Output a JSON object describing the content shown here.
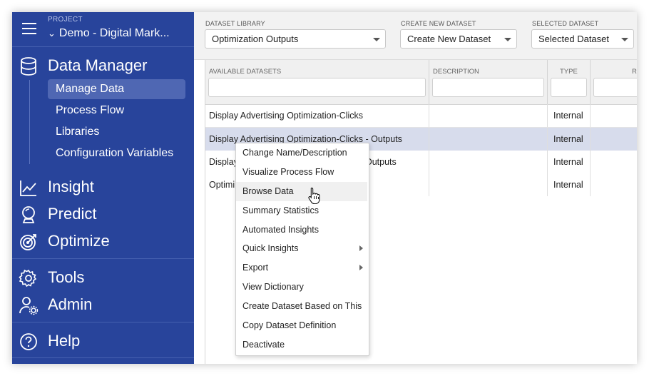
{
  "sidebar": {
    "project_label": "PROJECT",
    "project_name": "Demo - Digital Mark...",
    "data_manager": {
      "label": "Data Manager",
      "items": [
        {
          "label": "Manage Data",
          "active": true
        },
        {
          "label": "Process Flow",
          "active": false
        },
        {
          "label": "Libraries",
          "active": false
        },
        {
          "label": "Configuration Variables",
          "active": false
        }
      ]
    },
    "insight": "Insight",
    "predict": "Predict",
    "optimize": "Optimize",
    "tools": "Tools",
    "admin": "Admin",
    "help": "Help"
  },
  "toolbar": {
    "library_label": "DATASET LIBRARY",
    "library_value": "Optimization Outputs",
    "create_label": "CREATE NEW DATASET",
    "create_value": "Create New Dataset",
    "selected_label": "SELECTED DATASET",
    "selected_value": "Selected Dataset"
  },
  "grid": {
    "columns": [
      "AVAILABLE DATASETS",
      "DESCRIPTION",
      "TYPE",
      "R"
    ],
    "rows": [
      {
        "name": "Display Advertising Optimization-Clicks",
        "description": "",
        "type": "Internal"
      },
      {
        "name": "Display Advertising Optimization-Clicks - Outputs",
        "description": "",
        "type": "Internal"
      },
      {
        "name": "Display",
        "name_tail": "Outputs",
        "description": "",
        "type": "Internal"
      },
      {
        "name": "Optimi",
        "description": "",
        "type": "Internal"
      }
    ]
  },
  "context_menu": {
    "items": [
      {
        "label": "Change Name/Description",
        "submenu": false
      },
      {
        "label": "Visualize Process Flow",
        "submenu": false
      },
      {
        "label": "Browse Data",
        "submenu": false,
        "hover": true
      },
      {
        "label": "Summary Statistics",
        "submenu": false
      },
      {
        "label": "Automated Insights",
        "submenu": false
      },
      {
        "label": "Quick Insights",
        "submenu": true
      },
      {
        "label": "Export",
        "submenu": true
      },
      {
        "label": "View Dictionary",
        "submenu": false
      },
      {
        "label": "Create Dataset Based on This",
        "submenu": false
      },
      {
        "label": "Copy Dataset Definition",
        "submenu": false
      },
      {
        "label": "Deactivate",
        "submenu": false
      }
    ]
  },
  "colors": {
    "sidebar_bg": "#28449b",
    "sidebar_active": "#4f67b3",
    "row_selected": "#d7dcec"
  }
}
